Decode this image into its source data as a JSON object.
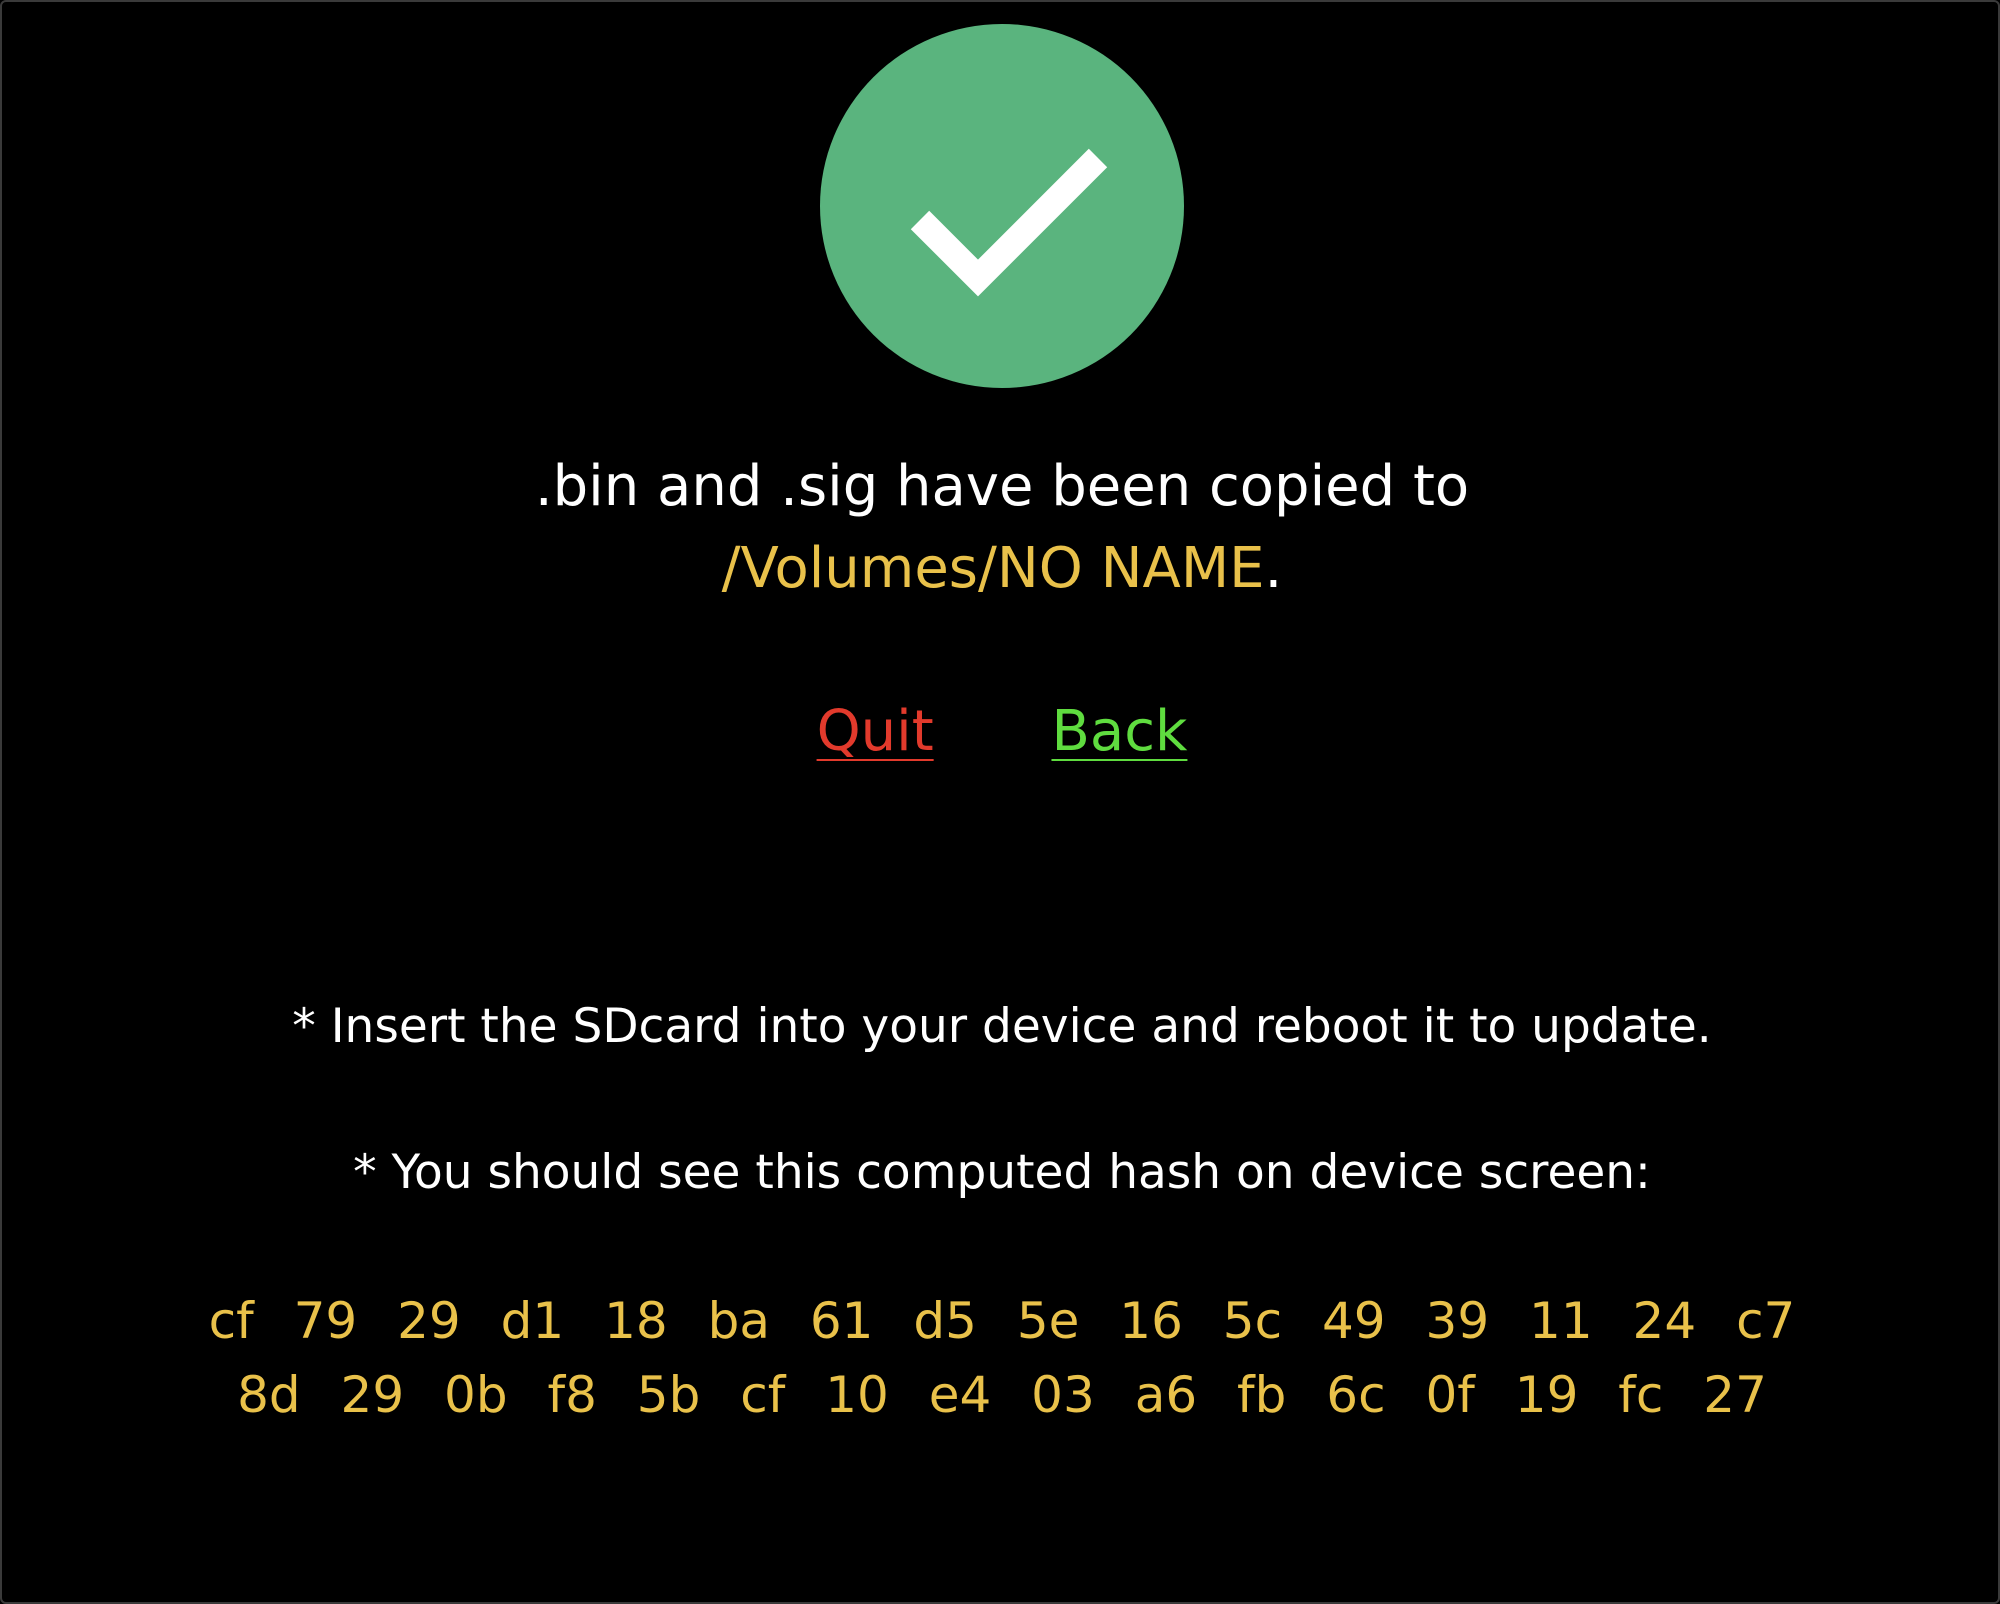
{
  "status": {
    "icon": "checkmark-icon",
    "icon_color": "#5ab47e"
  },
  "message": {
    "line1": ".bin and .sig have been copied to",
    "path": "/Volumes/NO NAME",
    "suffix": "."
  },
  "actions": {
    "quit_label": "Quit",
    "back_label": "Back",
    "quit_color": "#e23a2c",
    "back_color": "#5fdc3f"
  },
  "notes": {
    "insert": "* Insert the SDcard into your device and reboot it to update.",
    "hash_hint": "* You should see this computed hash on device screen:"
  },
  "hash": {
    "line1": "cf 79 29 d1 18 ba 61 d5 5e 16 5c 49 39 11 24 c7",
    "line2": "8d 29 0b f8 5b cf 10 e4 03 a6 fb 6c 0f 19 fc 27"
  }
}
